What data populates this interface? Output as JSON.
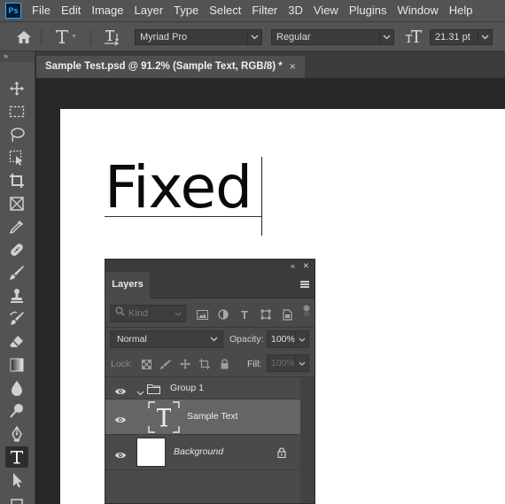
{
  "app": {
    "logo": "Ps"
  },
  "menu": [
    "File",
    "Edit",
    "Image",
    "Layer",
    "Type",
    "Select",
    "Filter",
    "3D",
    "View",
    "Plugins",
    "Window",
    "Help"
  ],
  "options": {
    "font_family": "Myriad Pro",
    "font_style": "Regular",
    "font_size": "21.31 pt"
  },
  "toolbar": {
    "collapse": "»",
    "tools": [
      "move-tool",
      "marquee-tool",
      "lasso-tool",
      "object-select-tool",
      "crop-tool",
      "frame-tool",
      "eyedropper-tool",
      "healing-tool",
      "brush-tool",
      "stamp-tool",
      "history-brush-tool",
      "eraser-tool",
      "gradient-tool",
      "blur-tool",
      "dodge-tool",
      "pen-tool",
      "type-tool",
      "path-select-tool"
    ],
    "active": "type-tool"
  },
  "document": {
    "tab_title": "Sample Test.psd @ 91.2% (Sample Text, RGB/8) *",
    "tab_close": "×",
    "canvas_text": "Fixed"
  },
  "layers_panel": {
    "tab_label": "Layers",
    "collapse": "«",
    "close": "✕",
    "filter_kind": "Kind",
    "blend_mode": "Normal",
    "opacity_label": "Opacity:",
    "opacity_value": "100%",
    "lock_label": "Lock:",
    "fill_label": "Fill:",
    "fill_value": "100%",
    "layers": [
      {
        "name": "Group 1",
        "type": "group",
        "visible": true,
        "expanded": true
      },
      {
        "name": "Sample Text",
        "type": "text",
        "visible": true,
        "selected": true
      },
      {
        "name": "Background",
        "type": "pixel",
        "visible": true,
        "locked": true
      }
    ]
  },
  "colors": {
    "ui_dark": "#282828",
    "ui_panel": "#535353",
    "selected_row": "#656565",
    "accent": "#31a8ff"
  }
}
